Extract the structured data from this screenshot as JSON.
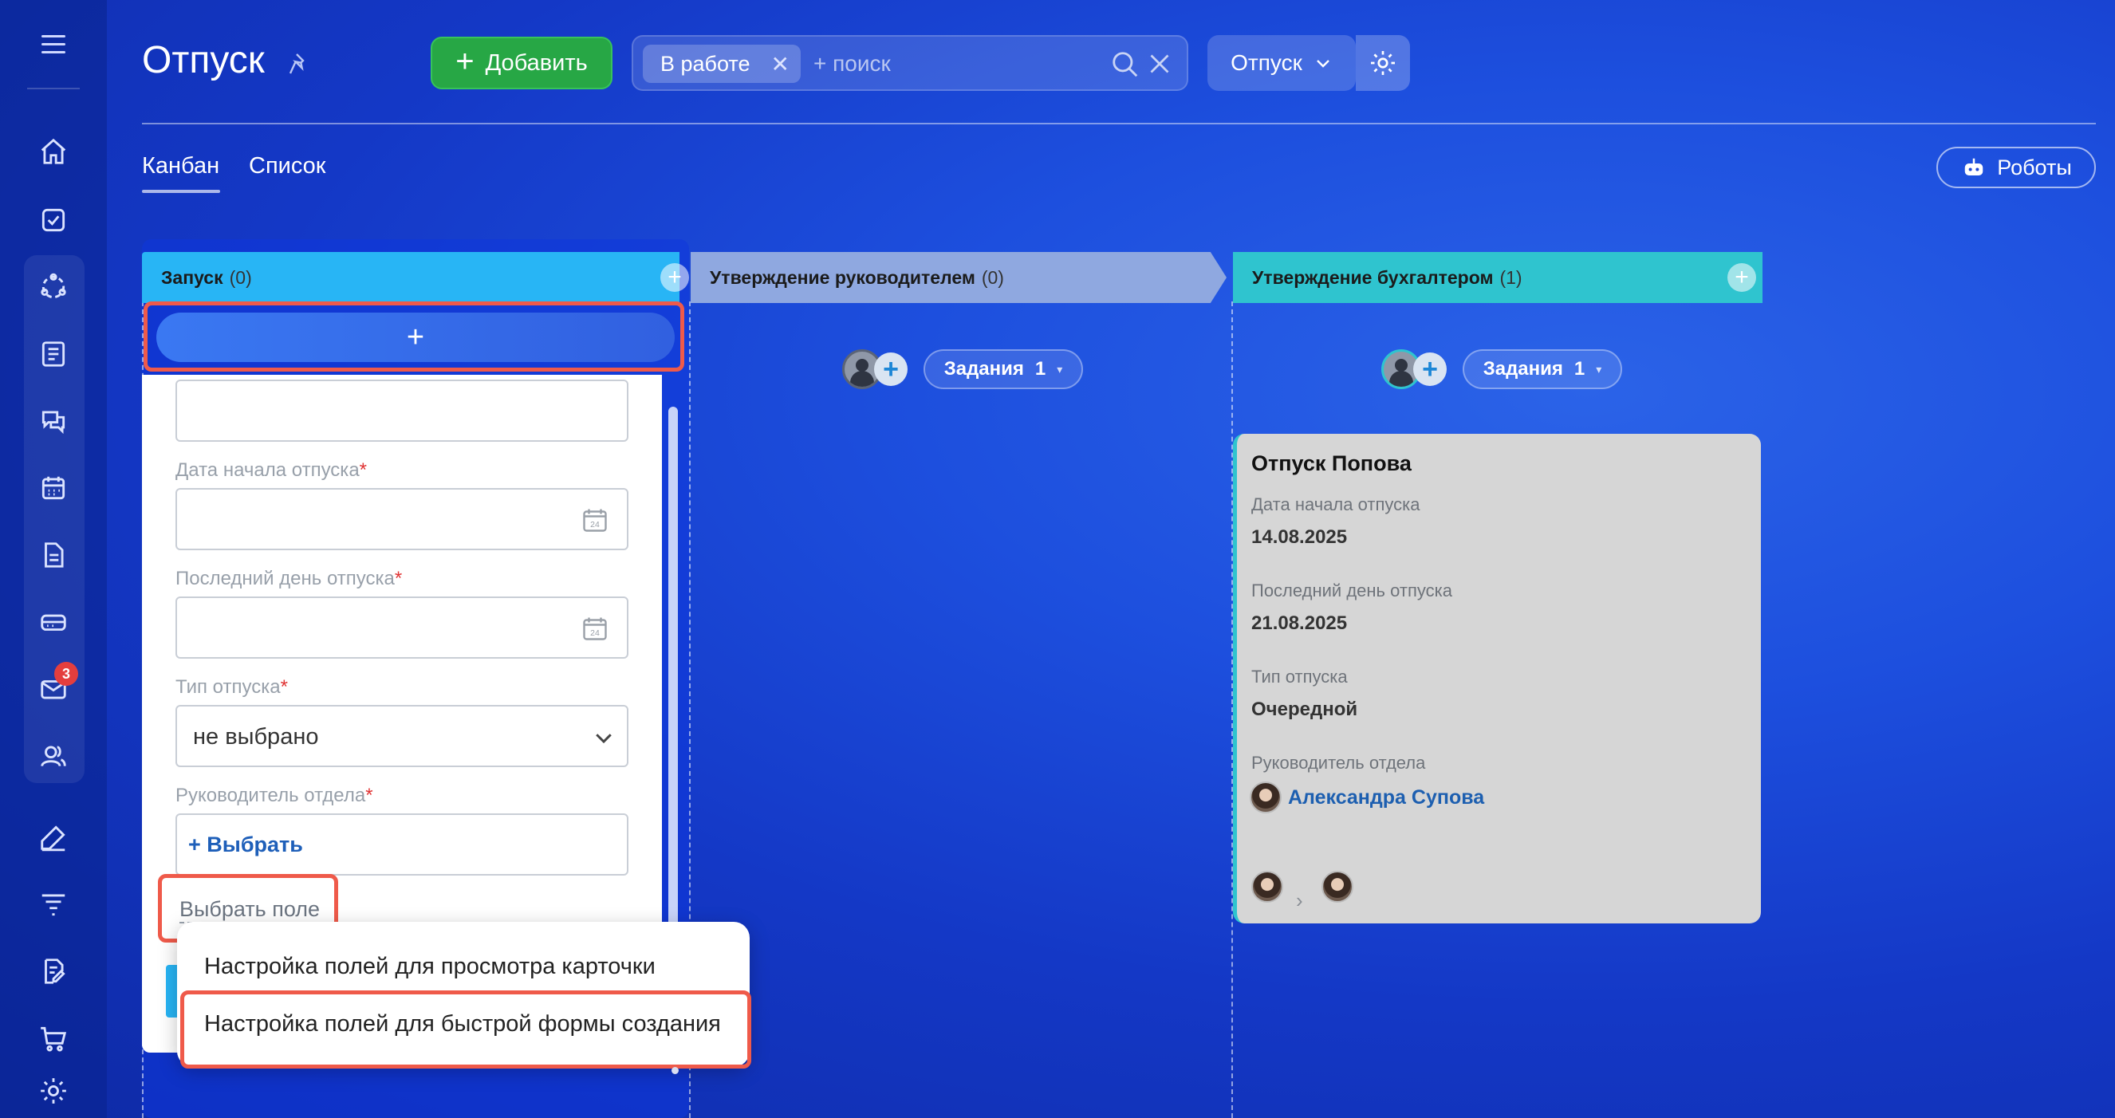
{
  "header": {
    "title": "Отпуск",
    "add_button": "Добавить",
    "filter_chip": "В работе",
    "search_placeholder": "+ поиск",
    "vacation_button": "Отпуск",
    "robots_button": "Роботы"
  },
  "tabs": [
    {
      "label": "Канбан",
      "active": true
    },
    {
      "label": "Список",
      "active": false
    }
  ],
  "sidebar": {
    "items": [
      {
        "icon": "menu-icon"
      },
      {
        "icon": "home-icon"
      },
      {
        "icon": "tasks-icon"
      },
      {
        "icon": "crm-icon"
      },
      {
        "icon": "feed-icon"
      },
      {
        "icon": "chat-icon"
      },
      {
        "icon": "calendar-icon"
      },
      {
        "icon": "documents-icon"
      },
      {
        "icon": "drive-icon"
      },
      {
        "icon": "mail-icon",
        "badge": "3"
      },
      {
        "icon": "employees-icon"
      },
      {
        "icon": "signature-icon"
      },
      {
        "icon": "filter-icon"
      },
      {
        "icon": "edit-doc-icon"
      },
      {
        "icon": "cart-icon"
      },
      {
        "icon": "settings-icon"
      }
    ]
  },
  "columns": [
    {
      "name": "Запуск",
      "count": "(0)",
      "color": "#28b5f5"
    },
    {
      "name": "Утверждение руководителем",
      "count": "(0)",
      "color": "#8fa8e0"
    },
    {
      "name": "Утверждение бухгалтером",
      "count": "(1)",
      "color": "#2fc4cf"
    }
  ],
  "quick_add": "+",
  "form": {
    "start_label": "Дата начала отпуска",
    "end_label": "Последний день отпуска",
    "type_label": "Тип отпуска",
    "type_value": "не выбрано",
    "manager_label": "Руководитель отдела",
    "manager_pick": "+ Выбрать",
    "required_mark": "*",
    "calendar_day": "24",
    "choose_field": "Выбрать поле"
  },
  "popup": {
    "item_view": "Настройка полей для просмотра карточки",
    "item_quick": "Настройка полей для быстрой формы создания"
  },
  "tasks": {
    "label": "Задания",
    "col2_count": "1",
    "col3_count": "1"
  },
  "card": {
    "title": "Отпуск Попова",
    "start_label": "Дата начала отпуска",
    "start_value": "14.08.2025",
    "end_label": "Последний день отпуска",
    "end_value": "21.08.2025",
    "type_label": "Тип отпуска",
    "type_value": "Очередной",
    "manager_label": "Руководитель отдела",
    "manager_name": "Александра Супова"
  },
  "colors": {
    "accent_green": "#27a745",
    "highlight_red": "#ef5a4a",
    "link_blue": "#1d5fb0"
  }
}
